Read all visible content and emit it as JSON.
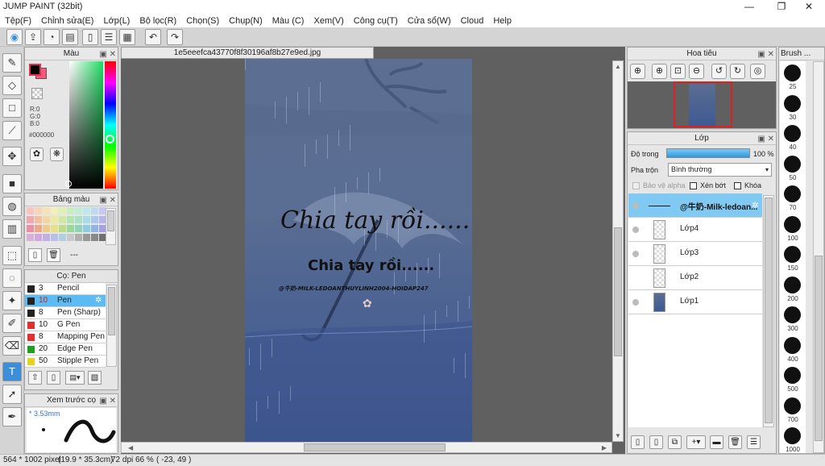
{
  "window": {
    "title": "JUMP PAINT (32bit)",
    "minimize": "—",
    "maximize": "❐",
    "close": "✕"
  },
  "menu": [
    "Tệp(F)",
    "Chỉnh sửa(E)",
    "Lớp(L)",
    "Bộ lọc(R)",
    "Chọn(S)",
    "Chụp(N)",
    "Màu (C)",
    "Xem(V)",
    "Công cụ(T)",
    "Cửa sổ(W)",
    "Cloud",
    "Help"
  ],
  "toolbar_icons": [
    "check-circle-icon",
    "export-icon",
    "chat-icon",
    "message-icon",
    "document-icon",
    "list-icon",
    "grid-icon",
    "undo-icon",
    "redo-icon"
  ],
  "color_panel": {
    "title": "Màu",
    "r": "R:0",
    "g": "G:0",
    "b": "B:0",
    "hex": "#000000",
    "foreground": "#000000",
    "background": "#ff5577"
  },
  "swatch_panel": {
    "title": "Bảng màu",
    "extra": "---"
  },
  "brush_panel": {
    "title": "Cọ: Pen",
    "items": [
      {
        "size": "3",
        "name": "Pencil",
        "color": "#222222"
      },
      {
        "size": "10",
        "name": "Pen",
        "color": "#222222",
        "selected": true
      },
      {
        "size": "8",
        "name": "Pen (Sharp)",
        "color": "#222222"
      },
      {
        "size": "10",
        "name": "G Pen",
        "color": "#e03030"
      },
      {
        "size": "8",
        "name": "Mapping Pen",
        "color": "#e03030"
      },
      {
        "size": "20",
        "name": "Edge Pen",
        "color": "#20a020"
      },
      {
        "size": "50",
        "name": "Stipple Pen",
        "color": "#e8d020"
      }
    ]
  },
  "preview_panel": {
    "title": "Xem trước cọ",
    "size": "* 3.53mm"
  },
  "document": {
    "tab": "1e5eeefca43770f8f30196af8b27e9ed.jpg"
  },
  "artwork": {
    "script_text": "Chia tay rồi......",
    "bold_text": "Chia tay rồi......",
    "credit": "@牛奶-MILK-LEDOANTHUYLINH2004-HOIDAP247"
  },
  "navigator": {
    "title": "Hoa tiêu"
  },
  "layers_panel": {
    "title": "Lớp",
    "opacity_label": "Độ trong",
    "opacity_value": "100 %",
    "opacity": 1.0,
    "blend_label": "Pha trộn",
    "blend_value": "Bình thường",
    "protect_alpha": "Bảo vệ alpha",
    "clip": "Xén bớt",
    "lock": "Khóa",
    "layers": [
      {
        "name": "@牛奶-Milk-ledoan...",
        "selected": true
      },
      {
        "name": "Lớp4"
      },
      {
        "name": "Lớp3"
      },
      {
        "name": "Lớp2"
      },
      {
        "name": "Lớp1"
      }
    ]
  },
  "brush_sizes": {
    "title": "Brush ...",
    "sizes": [
      "25",
      "30",
      "40",
      "50",
      "70",
      "100",
      "150",
      "200",
      "300",
      "400",
      "500",
      "700",
      "1000"
    ]
  },
  "status": {
    "pixels": "564 * 1002 pixel",
    "size_cm": "(19.9 * 35.3cm)",
    "dpi": "72 dpi",
    "zoom": "66 %",
    "coords": "( -23, 49 )"
  },
  "colors": {
    "accent": "#3b8fd9",
    "selection": "#5cbbf2",
    "canvas_bg": "#606060",
    "nav_frame": "#e02020"
  }
}
